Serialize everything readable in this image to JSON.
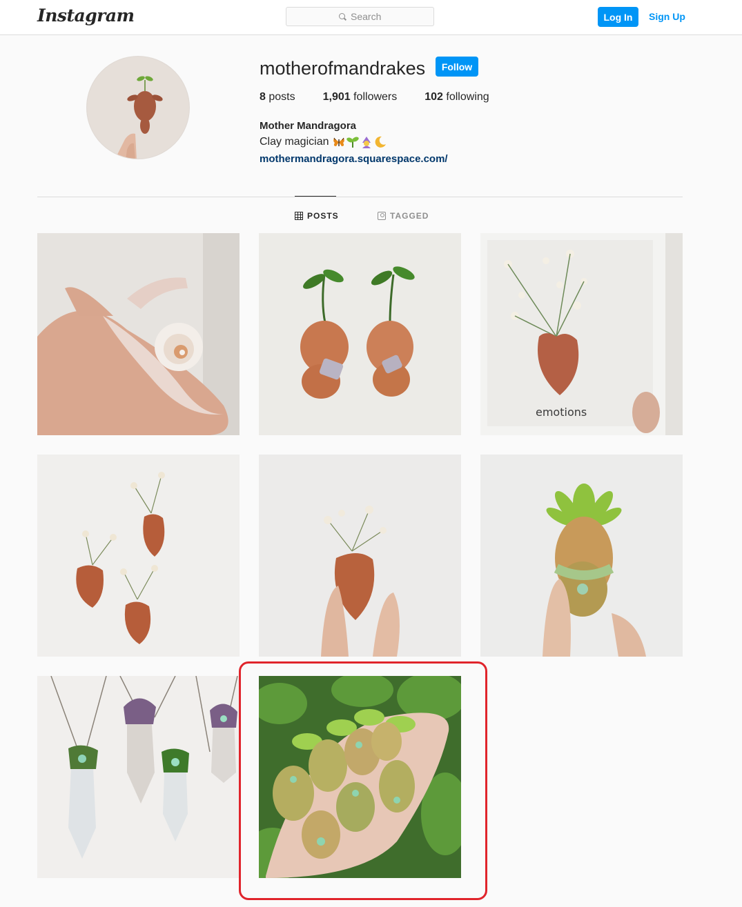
{
  "nav": {
    "logo": "Instagram",
    "search_placeholder": "Search",
    "login_label": "Log In",
    "signup_label": "Sign Up"
  },
  "profile": {
    "username": "motherofmandrakes",
    "follow_label": "Follow",
    "stats": {
      "posts_count": "8",
      "posts_label": "posts",
      "followers_count": "1,901",
      "followers_label": "followers",
      "following_count": "102",
      "following_label": "following"
    },
    "full_name": "Mother Mandragora",
    "bio": "Clay magician",
    "bio_emojis": [
      "butterfly-icon",
      "seedling-icon",
      "mage-icon",
      "crescent-moon-icon"
    ],
    "website": "mothermandragora.squarespace.com/"
  },
  "tabs": [
    {
      "label": "POSTS",
      "icon": "grid-icon",
      "active": true
    },
    {
      "label": "TAGGED",
      "icon": "tag-icon",
      "active": false
    }
  ],
  "posts": [
    {
      "subject": "clay snail on hand"
    },
    {
      "subject": "two sprouting mandrake figures"
    },
    {
      "subject": "framed clay heart with flowers"
    },
    {
      "subject": "three clay heart vases"
    },
    {
      "subject": "clay heart vase held in fingers"
    },
    {
      "subject": "green succulent mandrake figure"
    },
    {
      "subject": "crystal mandrake pendants"
    },
    {
      "subject": "handful of green mandrake figures"
    }
  ],
  "colors": {
    "accent": "#0095f6",
    "highlight": "#e0242b",
    "link": "#00376b"
  }
}
